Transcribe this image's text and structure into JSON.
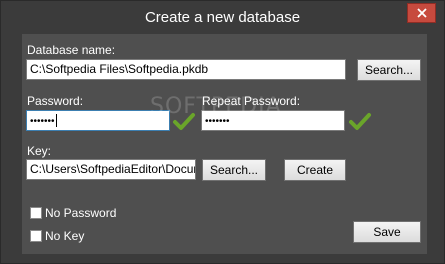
{
  "window": {
    "title": "Create a new database",
    "close_icon": "close-icon"
  },
  "database": {
    "label": "Database name:",
    "value": "C:\\Softpedia Files\\Softpedia.pkdb",
    "search_label": "Search..."
  },
  "password": {
    "label": "Password:",
    "value": "•••••••",
    "check_icon": "checkmark-icon"
  },
  "repeat_password": {
    "label": "Repeat Password:",
    "value": "•••••••",
    "check_icon": "checkmark-icon"
  },
  "key": {
    "label": "Key:",
    "value": "C:\\Users\\SoftpediaEditor\\Documer",
    "search_label": "Search...",
    "create_label": "Create"
  },
  "options": {
    "no_password": "No Password",
    "no_key": "No Key"
  },
  "save_label": "Save",
  "watermark": "SOFTPEDIA",
  "colors": {
    "background": "#3b3b3b",
    "panel": "#4f4f4f",
    "close": "#c74a3e",
    "check": "#6aa52a"
  }
}
